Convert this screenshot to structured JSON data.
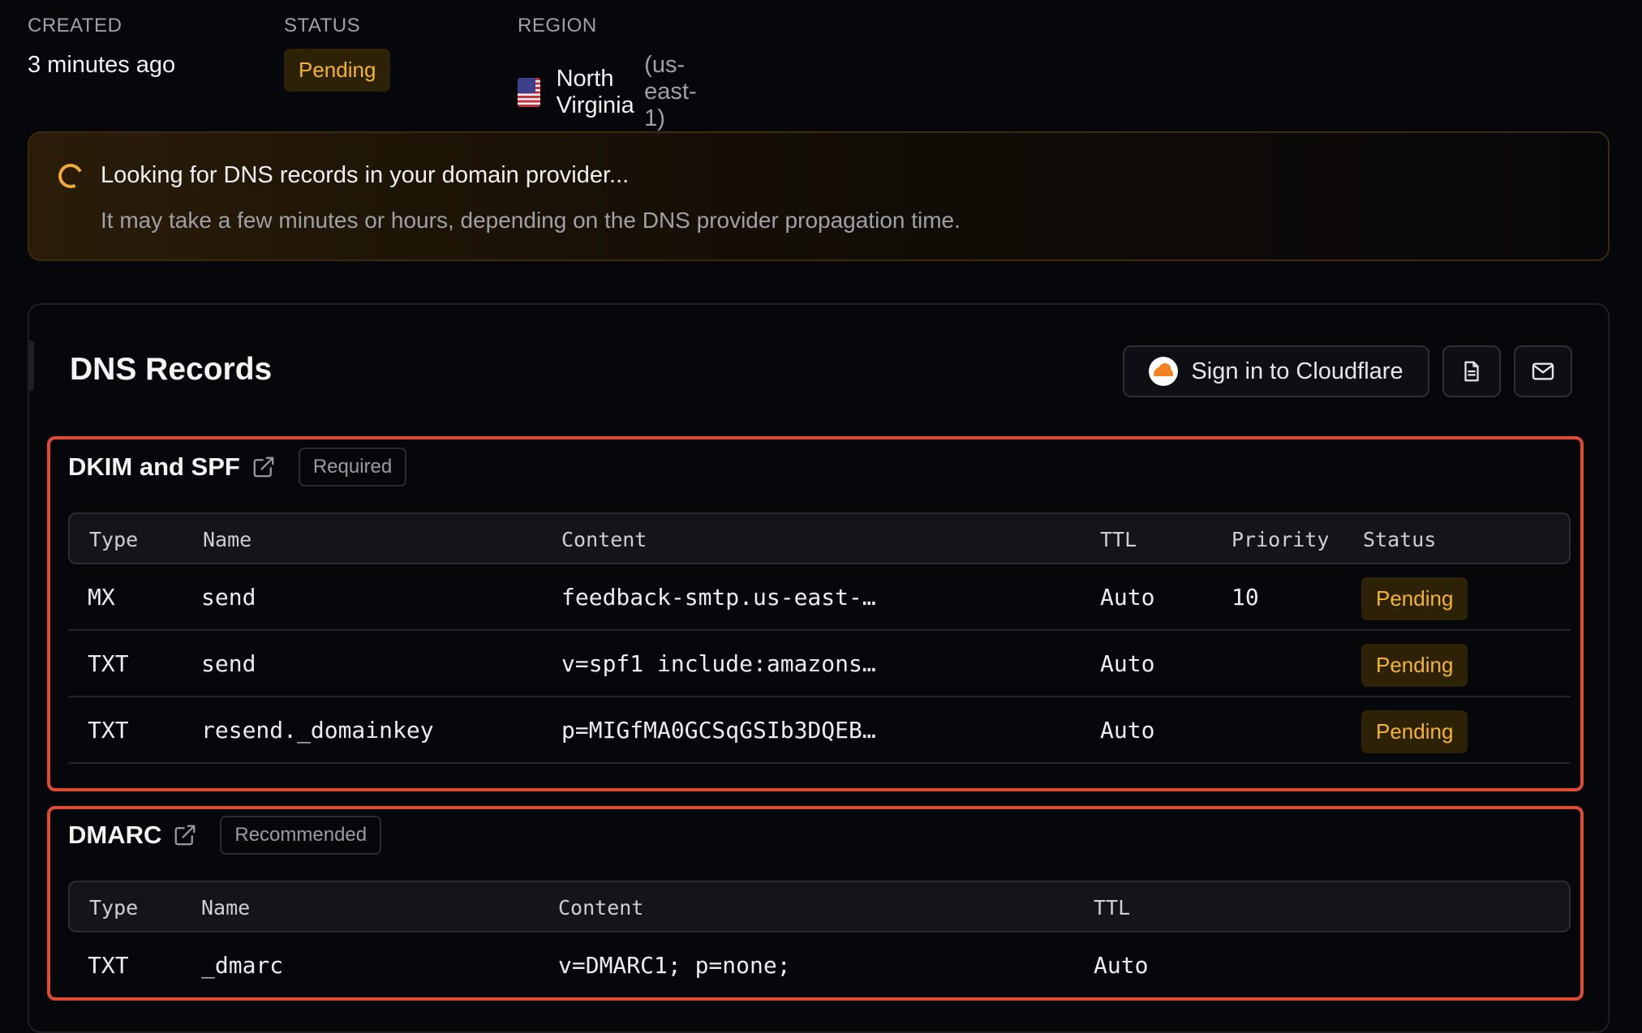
{
  "meta": {
    "created": {
      "label": "CREATED",
      "value": "3 minutes ago"
    },
    "status": {
      "label": "STATUS",
      "value": "Pending"
    },
    "region": {
      "label": "REGION",
      "value": "North Virginia",
      "code": "(us-east-1)",
      "flag_icon": "us-flag-icon"
    }
  },
  "banner": {
    "title": "Looking for DNS records in your domain provider...",
    "subtitle": "It may take a few minutes or hours, depending on the DNS provider propagation time."
  },
  "dns": {
    "title": "DNS Records",
    "cloudflare_button": "Sign in to Cloudflare",
    "doc_icon": "document-icon",
    "mail_icon": "mail-icon",
    "sections": [
      {
        "name": "DKIM and SPF",
        "badge": "Required",
        "columns": [
          "Type",
          "Name",
          "Content",
          "TTL",
          "Priority",
          "Status"
        ],
        "rows": [
          {
            "type": "MX",
            "name": "send",
            "content": "feedback-smtp.us-east-…",
            "ttl": "Auto",
            "priority": "10",
            "status": "Pending"
          },
          {
            "type": "TXT",
            "name": "send",
            "content": "v=spf1 include:amazons…",
            "ttl": "Auto",
            "priority": "",
            "status": "Pending"
          },
          {
            "type": "TXT",
            "name": "resend._domainkey",
            "content": "p=MIGfMA0GCSqGSIb3DQEB…",
            "ttl": "Auto",
            "priority": "",
            "status": "Pending"
          }
        ]
      },
      {
        "name": "DMARC",
        "badge": "Recommended",
        "columns": [
          "Type",
          "Name",
          "Content",
          "TTL"
        ],
        "rows": [
          {
            "type": "TXT",
            "name": "_dmarc",
            "content": "v=DMARC1; p=none;",
            "ttl": "Auto"
          }
        ]
      }
    ]
  },
  "colors": {
    "background": "#06070b",
    "pending_text": "#f5b524",
    "pending_bg": "#2d2206",
    "highlight_border": "#e24a36",
    "spinner": "#f3ab2e"
  }
}
